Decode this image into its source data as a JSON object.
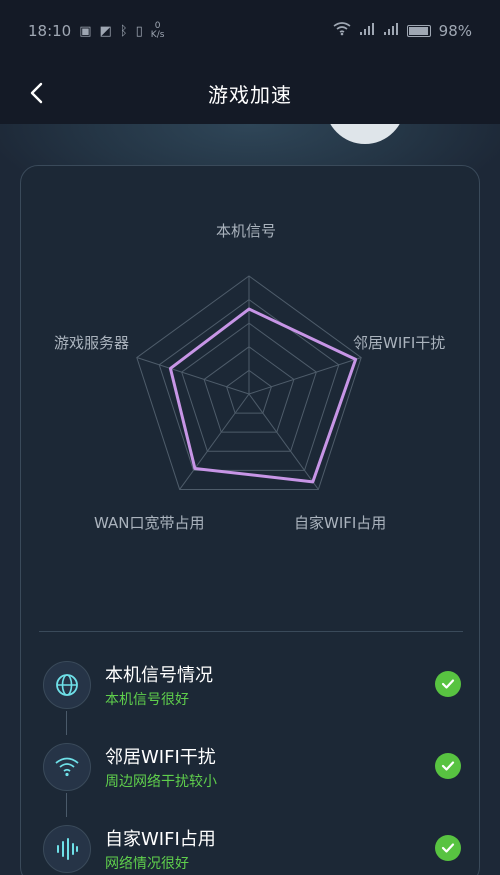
{
  "status_bar": {
    "time": "18:10",
    "speed_value": "0",
    "speed_unit": "K/s",
    "battery": "98%"
  },
  "nav": {
    "title": "游戏加速"
  },
  "hero": {
    "value_1": "",
    "value_2": ""
  },
  "radar": {
    "axes": [
      "本机信号",
      "邻居WIFI干扰",
      "自家WIFI占用",
      "WAN口宽带占用",
      "游戏服务器"
    ],
    "max": 1.0,
    "levels": 5,
    "values": [
      0.72,
      0.95,
      0.92,
      0.78,
      0.7
    ],
    "grid_color": "#4e5c6a",
    "line_color": "#c795e6"
  },
  "checks": [
    {
      "title": "本机信号情况",
      "status": "本机信号很好",
      "icon": "globe-icon"
    },
    {
      "title": "邻居WIFI干扰",
      "status": "周边网络干扰较小",
      "icon": "wifi-icon"
    },
    {
      "title": "自家WIFI占用",
      "status": "网络情况很好",
      "icon": "soundwave-icon"
    }
  ],
  "colors": {
    "accent_green": "#58c341",
    "background": "#1d2837",
    "card": "#1c2836"
  }
}
